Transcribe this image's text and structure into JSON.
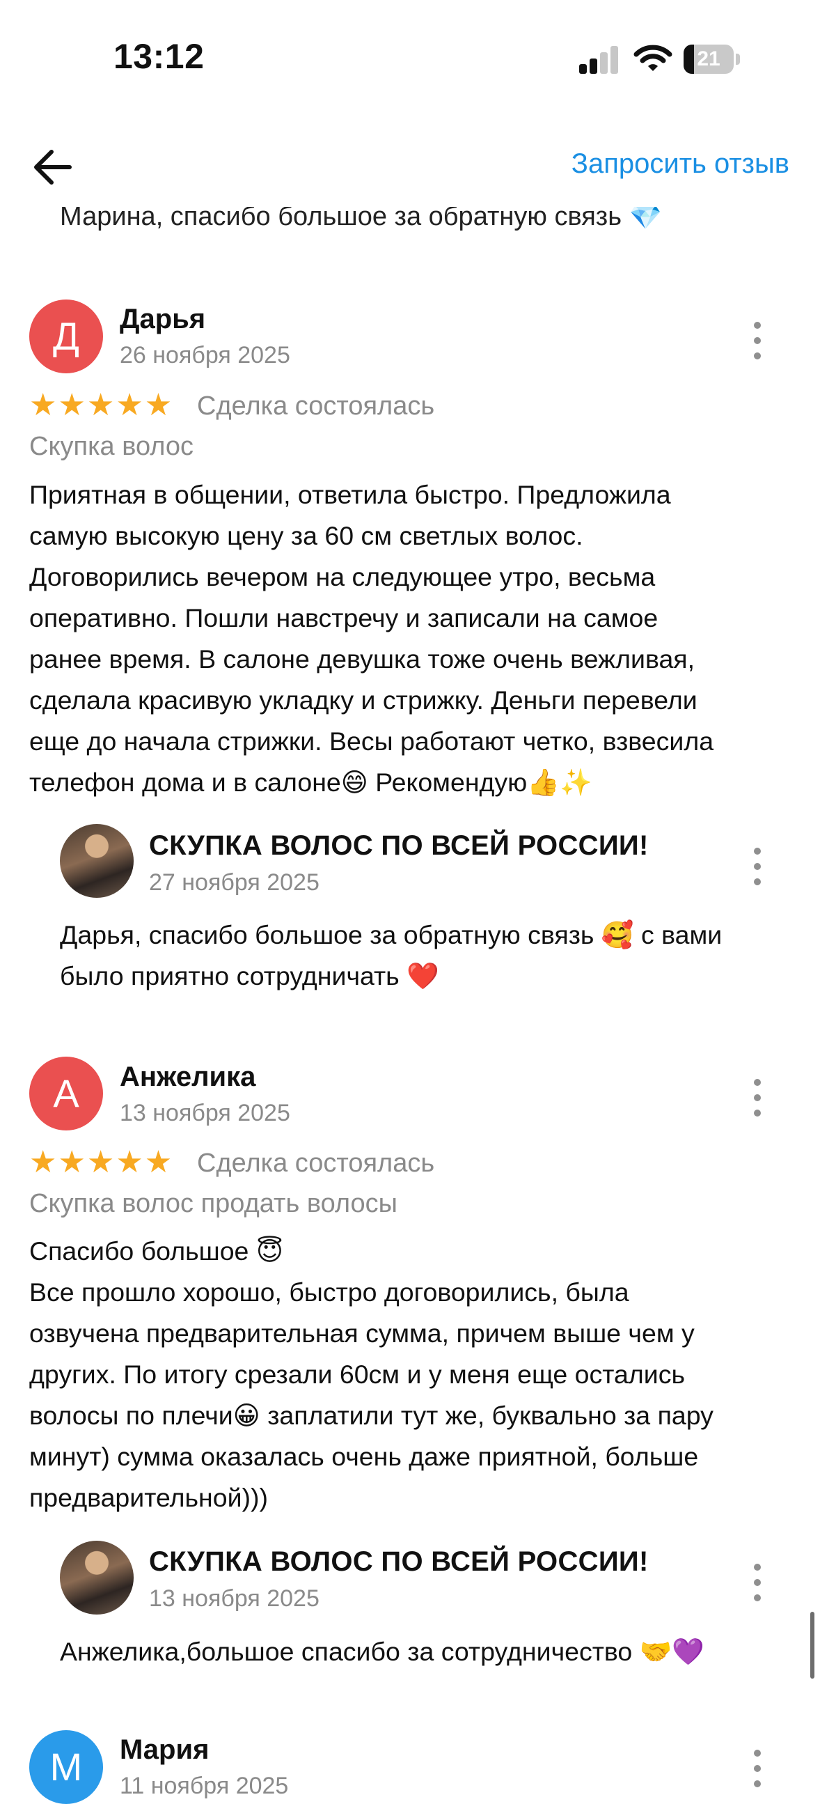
{
  "status_bar": {
    "time": "13:12",
    "battery": "21",
    "battery_level": 0.21
  },
  "header": {
    "request_review_label": "Запросить отзыв"
  },
  "previous_reply_clipped": "Марина, спасибо большое за обратную связь 💎",
  "reviews": [
    {
      "avatar_letter": "Д",
      "name": "Дарья",
      "date": "26 ноября 2025",
      "stars": "★★★★★",
      "rating": 5,
      "deal_status": "Сделка состоялась",
      "service": "Скупка волос",
      "text": "Приятная в общении, ответила быстро. Предложила\nсамую высокую цену за 60 см светлых волос.\nДоговорились вечером на следующее утро, весьма\nоперативно. Пошли навстречу и записали на самое\nранее время. В салоне девушка тоже очень вежливая,\nсделала красивую укладку и стрижку. Деньги перевели\nеще до начала стрижки. Весы работают четко, взвесила\nтелефон дома и в салоне😄 Рекомендую👍✨",
      "reply": {
        "name": "СКУПКА ВОЛОС ПО ВСЕЙ РОССИИ!",
        "date": "27 ноября 2025",
        "text": "Дарья, спасибо большое за обратную связь 🥰 с вами\nбыло приятно сотрудничать ❤️"
      }
    },
    {
      "avatar_letter": "А",
      "name": "Анжелика",
      "date": "13 ноября 2025",
      "stars": "★★★★★",
      "rating": 5,
      "deal_status": "Сделка состоялась",
      "service": "Скупка волос продать волосы",
      "text": "Спасибо большое 😇\nВсе прошло хорошо, быстро договорились, была\nозвучена предварительная сумма, причем выше чем у\nдругих. По итогу срезали 60см и у меня еще остались\nволосы по плечи😀 заплатили тут же, буквально за пару\nминут) сумма оказалась очень даже приятной, больше\nпредварительной)))",
      "reply": {
        "name": "СКУПКА ВОЛОС ПО ВСЕЙ РОССИИ!",
        "date": "13 ноября 2025",
        "text": "Анжелика,большое спасибо за сотрудничество 🤝💜"
      }
    },
    {
      "avatar_letter": "М",
      "name": "Мария",
      "date": "11 ноября 2025"
    }
  ],
  "colors": {
    "accent": "#1a8fe3",
    "star": "#f8a922",
    "avatar_red": "#ea5050",
    "avatar_blue": "#2a9bea"
  }
}
